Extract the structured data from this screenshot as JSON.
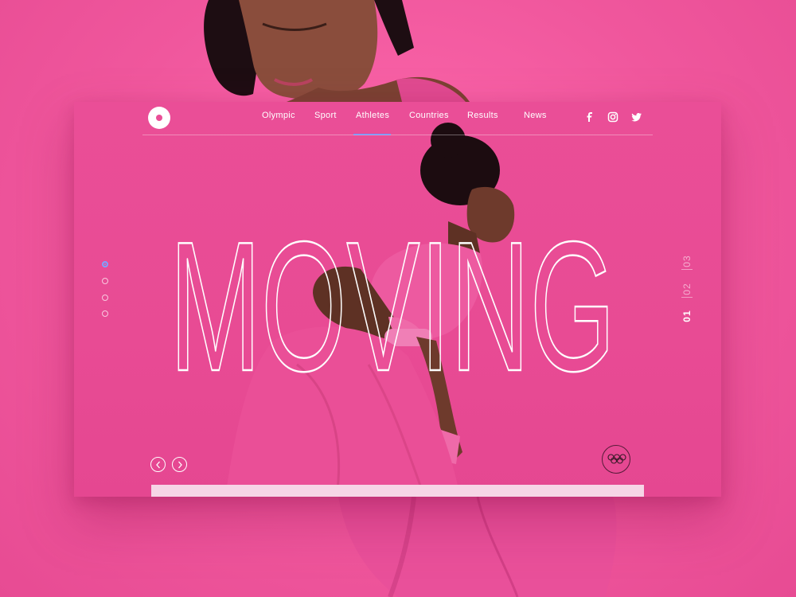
{
  "nav": {
    "items": [
      {
        "label": "Olympic"
      },
      {
        "label": "Sport"
      },
      {
        "label": "Athletes",
        "active": true
      },
      {
        "label": "Countries"
      },
      {
        "label": "Results"
      },
      {
        "label": "News"
      }
    ],
    "social_icons": [
      "facebook-icon",
      "instagram-icon",
      "twitter-icon"
    ]
  },
  "hero": {
    "title": "MOVING",
    "title_style": "outline"
  },
  "slides": {
    "count": 4,
    "active_index": 0
  },
  "counter": {
    "items": [
      "01",
      "02",
      "03"
    ],
    "current": "01"
  },
  "controls": {
    "prev_icon": "chevron-left-icon",
    "next_icon": "chevron-right-icon",
    "rings_icon": "olympic-rings-icon"
  },
  "colors": {
    "background": "#f0579d",
    "card": "#ea4e97",
    "accent": "#6f8cff",
    "text": "#ffffff"
  }
}
